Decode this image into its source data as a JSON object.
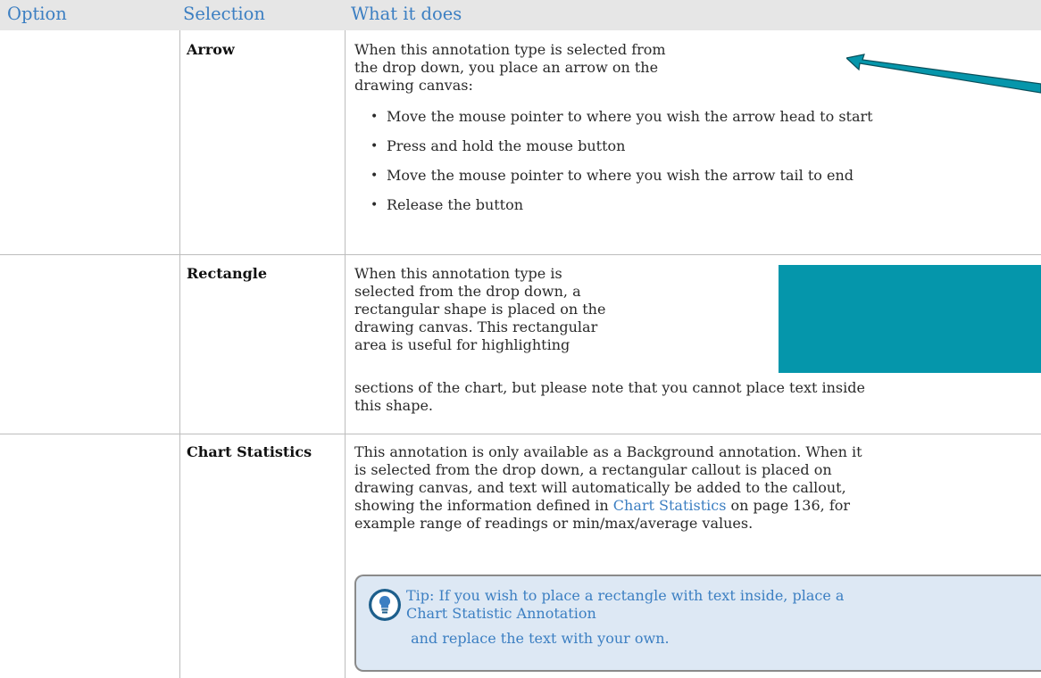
{
  "header": {
    "col_option": "Option",
    "col_selection": "Selection",
    "col_what": "What it does"
  },
  "rows": [
    {
      "selection": "Arrow",
      "intro": [
        "When this annotation type is selected from",
        "the drop down, you place an arrow on the",
        "drawing canvas:"
      ],
      "bullets": [
        "Move the mouse pointer to where you wish the arrow head to start",
        "Press and hold the mouse button",
        "Move the mouse pointer to where you wish the arrow tail to end",
        "Release the button"
      ]
    },
    {
      "selection": "Rectangle",
      "lines": [
        "When this annotation type is",
        "selected from the drop down, a",
        "rectangular shape is placed on the",
        "drawing canvas. This rectangular",
        "area is useful for highlighting",
        "sections of the chart, but please note that you cannot place text inside",
        "this shape."
      ]
    },
    {
      "selection": "Chart Statistics",
      "lines": [
        "This annotation is only available as a Background annotation. When it",
        "is selected from the drop down, a rectangular callout is placed on",
        "drawing canvas, and text will automatically be added to the callout,"
      ],
      "line4_pre": "showing the information defined in ",
      "line4_link": "Chart Statistics",
      "line4_post": " on page 136, for",
      "line5": "example range of readings or min/max/average values."
    }
  ],
  "tip": {
    "line1": "Tip: If you wish to place a rectangle with text inside, place a",
    "line2": "Chart Statistic Annotation",
    "line3": " and replace the text with your own."
  },
  "colors": {
    "accent": "#3c7fc2",
    "teal": "#0596ab",
    "header_bg": "#e6e6e6",
    "tip_bg": "#dde8f4"
  }
}
